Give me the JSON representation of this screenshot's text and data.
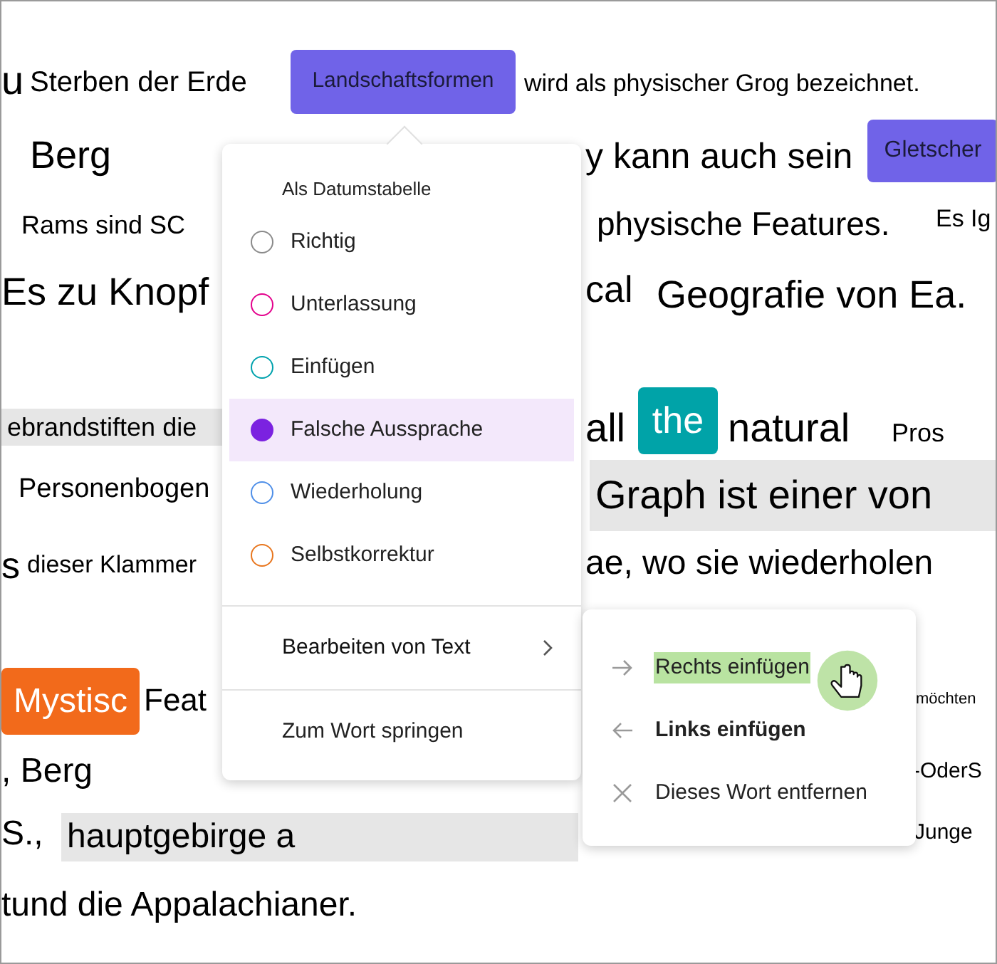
{
  "document": {
    "words": [
      {
        "kind": "plain",
        "text": "u"
      },
      {
        "kind": "plain",
        "text": "Sterben der Erde"
      },
      {
        "kind": "tag",
        "text": "Landschaftsformen",
        "color": "#7063e8",
        "light_text": false
      },
      {
        "kind": "plain",
        "text": "wird als physischer Grog bezeichnet."
      },
      {
        "kind": "plain",
        "text": "Berg"
      },
      {
        "kind": "plain",
        "text": "y kann auch sein"
      },
      {
        "kind": "tag",
        "text": "Gletscher",
        "color": "#7063e8",
        "light_text": false
      },
      {
        "kind": "plain",
        "text": "Rams sind SC"
      },
      {
        "kind": "plain",
        "text": "physische Features."
      },
      {
        "kind": "plain",
        "text": "Es Ig"
      },
      {
        "kind": "plain",
        "text": "Es zu Knopf"
      },
      {
        "kind": "plain",
        "text": "cal"
      },
      {
        "kind": "plain",
        "text": "Geografie von Ea."
      },
      {
        "kind": "shaded",
        "text": "ebrandstiften die"
      },
      {
        "kind": "plain",
        "text": "all"
      },
      {
        "kind": "tag",
        "text": "the",
        "color": "#00a3a8",
        "light_text": true
      },
      {
        "kind": "plain",
        "text": "natural"
      },
      {
        "kind": "plain",
        "text": "Pros"
      },
      {
        "kind": "plain",
        "text": "Personenbogen"
      },
      {
        "kind": "shaded",
        "text": "Graph ist einer von"
      },
      {
        "kind": "plain",
        "text": "s"
      },
      {
        "kind": "plain",
        "text": "dieser Klammer"
      },
      {
        "kind": "plain",
        "text": "ae, wo sie wiederholen"
      },
      {
        "kind": "tag",
        "text": "Mystisc",
        "color": "#f26a1b",
        "light_text": true
      },
      {
        "kind": "plain",
        "text": "Feat"
      },
      {
        "kind": "plain",
        "text": "möchten"
      },
      {
        "kind": "plain",
        "text": ", Berg"
      },
      {
        "kind": "plain",
        "text": "-OderS"
      },
      {
        "kind": "plain",
        "text": "S.,"
      },
      {
        "kind": "shaded",
        "text": "hauptgebirge a"
      },
      {
        "kind": "plain",
        "text": "Junge"
      },
      {
        "kind": "plain",
        "text": "tund die Appalachianer."
      }
    ]
  },
  "context_menu": {
    "header": "Als Datumstabelle",
    "items": [
      {
        "kind": "radio",
        "label": "Richtig",
        "color": "#8a8a8a",
        "selected": false
      },
      {
        "kind": "radio",
        "label": "Unterlassung",
        "color": "#e3008c",
        "selected": false
      },
      {
        "kind": "radio",
        "label": "Einfügen",
        "color": "#00a2ad",
        "selected": false
      },
      {
        "kind": "radio",
        "label": "Falsche Aussprache",
        "color": "#7b22e0",
        "selected": true
      },
      {
        "kind": "radio",
        "label": "Wiederholung",
        "color": "#4f8fe8",
        "selected": false
      },
      {
        "kind": "radio",
        "label": "Selbstkorrektur",
        "color": "#e8761e",
        "selected": false
      },
      {
        "kind": "submenu",
        "label": "Bearbeiten von Text",
        "expanded": true
      },
      {
        "kind": "action",
        "label": "Zum Wort springen"
      }
    ]
  },
  "submenu": {
    "items": [
      {
        "kind": "insert-right",
        "label": "Rechts einfügen",
        "highlighted": true,
        "bold": false
      },
      {
        "kind": "insert-left",
        "label": "Links einfügen",
        "highlighted": false,
        "bold": true
      },
      {
        "kind": "remove",
        "label": "Dieses Wort entfernen",
        "highlighted": false,
        "bold": false
      }
    ]
  }
}
